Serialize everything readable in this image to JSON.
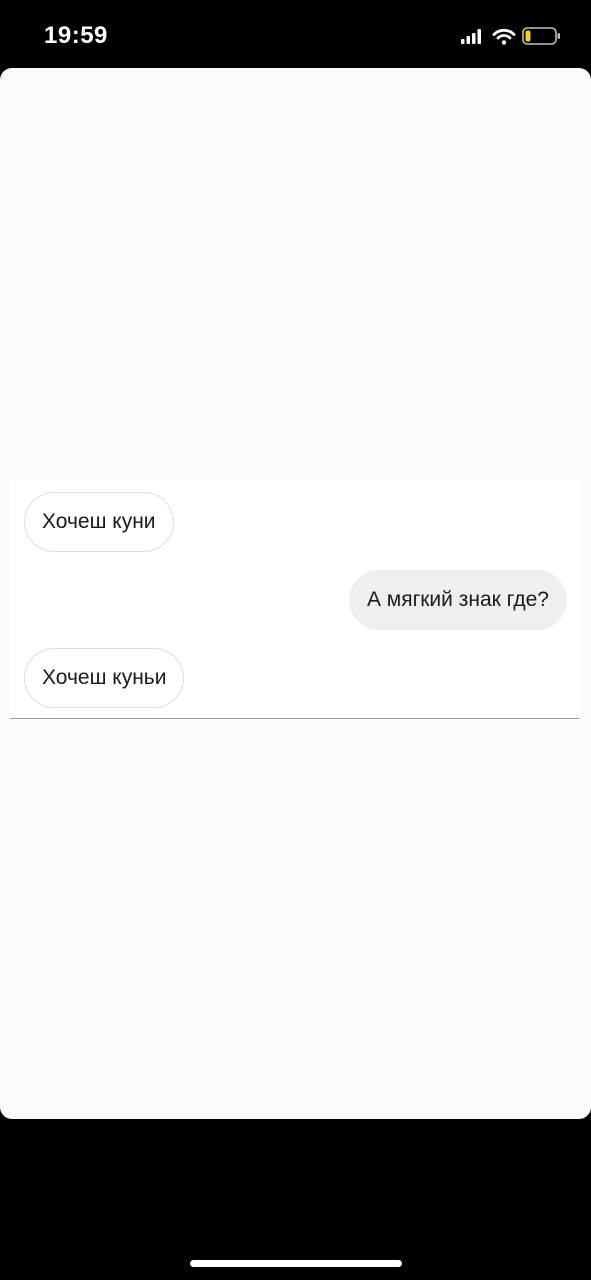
{
  "status_bar": {
    "time": "19:59",
    "icons": [
      "cellular-signal-icon",
      "wifi-icon",
      "battery-low-icon"
    ],
    "battery_color": "#f7d400"
  },
  "chat": {
    "messages": [
      {
        "direction": "incoming",
        "text": "Хочеш куни"
      },
      {
        "direction": "outgoing",
        "text": "А мягкий знак где?"
      },
      {
        "direction": "incoming",
        "text": "Хочеш куньи"
      }
    ]
  },
  "colors": {
    "background": "#000000",
    "sheet": "#fbfbfb",
    "incoming_bubble": "#ffffff",
    "incoming_border": "#dedede",
    "outgoing_bubble": "#efefef",
    "text": "#1a1a1a"
  }
}
